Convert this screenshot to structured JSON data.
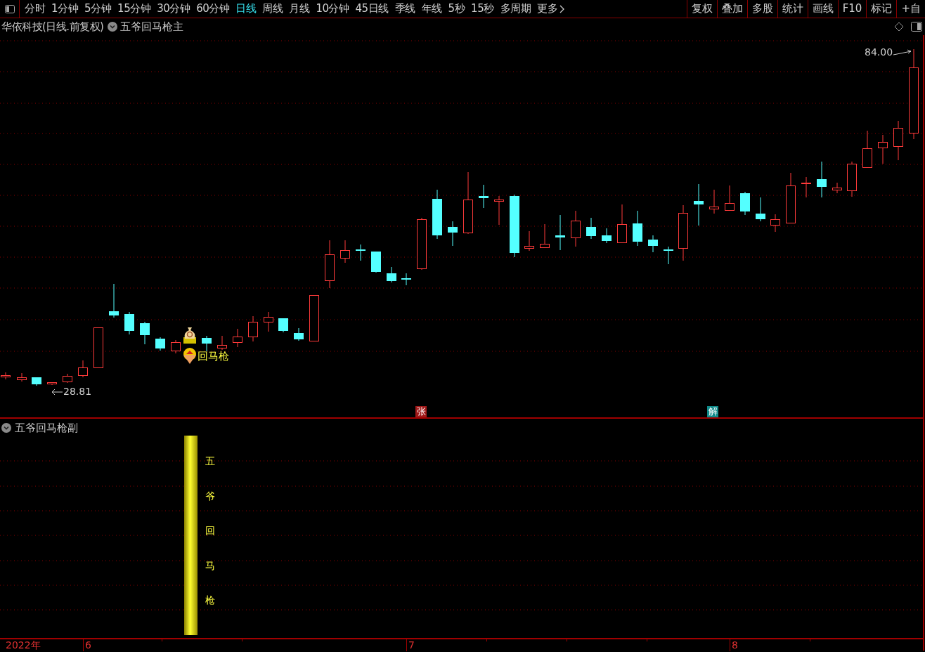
{
  "toolbar": {
    "periods": [
      {
        "label": "分时",
        "selected": false
      },
      {
        "label": "1分钟",
        "selected": false
      },
      {
        "label": "5分钟",
        "selected": false
      },
      {
        "label": "15分钟",
        "selected": false
      },
      {
        "label": "30分钟",
        "selected": false
      },
      {
        "label": "60分钟",
        "selected": false
      },
      {
        "label": "日线",
        "selected": true
      },
      {
        "label": "周线",
        "selected": false
      },
      {
        "label": "月线",
        "selected": false
      },
      {
        "label": "10分钟",
        "selected": false
      },
      {
        "label": "45日线",
        "selected": false
      },
      {
        "label": "季线",
        "selected": false
      },
      {
        "label": "年线",
        "selected": false
      },
      {
        "label": "5秒",
        "selected": false
      },
      {
        "label": "15秒",
        "selected": false
      },
      {
        "label": "多周期",
        "selected": false
      }
    ],
    "more": "更多",
    "tools": [
      "复权",
      "叠加",
      "多股",
      "统计",
      "画线",
      "F10",
      "标记",
      "+自"
    ]
  },
  "chart": {
    "title": "华依科技(日线.前复权)",
    "indicator": "五爷回马枪主",
    "high_label": "84.00",
    "low_label": "28.81",
    "signal": "回马枪",
    "badges": [
      {
        "text": "张",
        "color": "#a01818"
      },
      {
        "text": "解",
        "color": "#0f8a8a"
      }
    ]
  },
  "indicator_panel": {
    "title": "五爷回马枪副",
    "bar_text": "五爷回马枪"
  },
  "axis": {
    "labels": [
      "2022年",
      "6",
      "7",
      "8"
    ]
  }
}
